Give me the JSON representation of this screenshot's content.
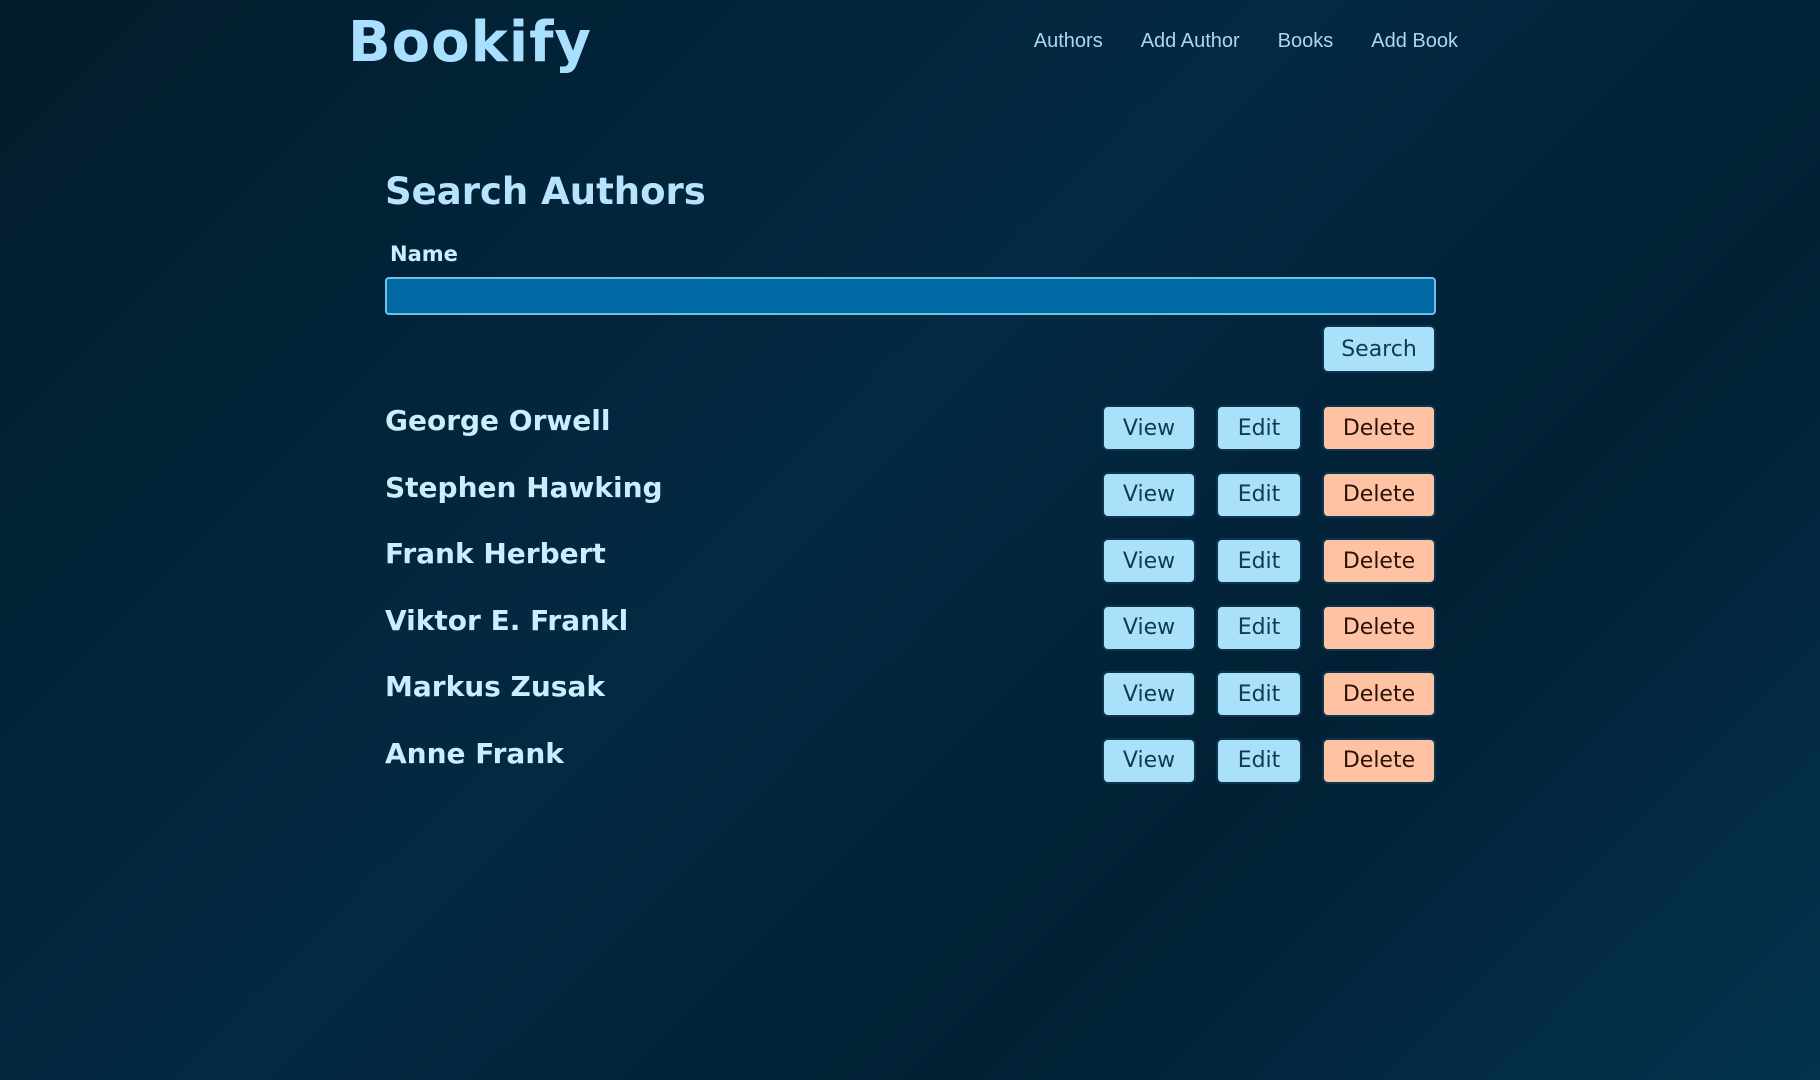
{
  "header": {
    "logo": "Bookify",
    "nav": [
      "Authors",
      "Add Author",
      "Books",
      "Add Book"
    ]
  },
  "search": {
    "title": "Search Authors",
    "label": "Name",
    "value": "",
    "button": "Search"
  },
  "authors": [
    {
      "name": "George Orwell"
    },
    {
      "name": "Stephen Hawking"
    },
    {
      "name": "Frank Herbert"
    },
    {
      "name": "Viktor E. Frankl"
    },
    {
      "name": "Markus Zusak"
    },
    {
      "name": "Anne Frank"
    }
  ],
  "actions": {
    "view": "View",
    "edit": "Edit",
    "delete": "Delete"
  },
  "colors": {
    "button_primary": "#a9e1fb",
    "button_danger": "#ffc3a4",
    "input_background": "#0069a3"
  }
}
